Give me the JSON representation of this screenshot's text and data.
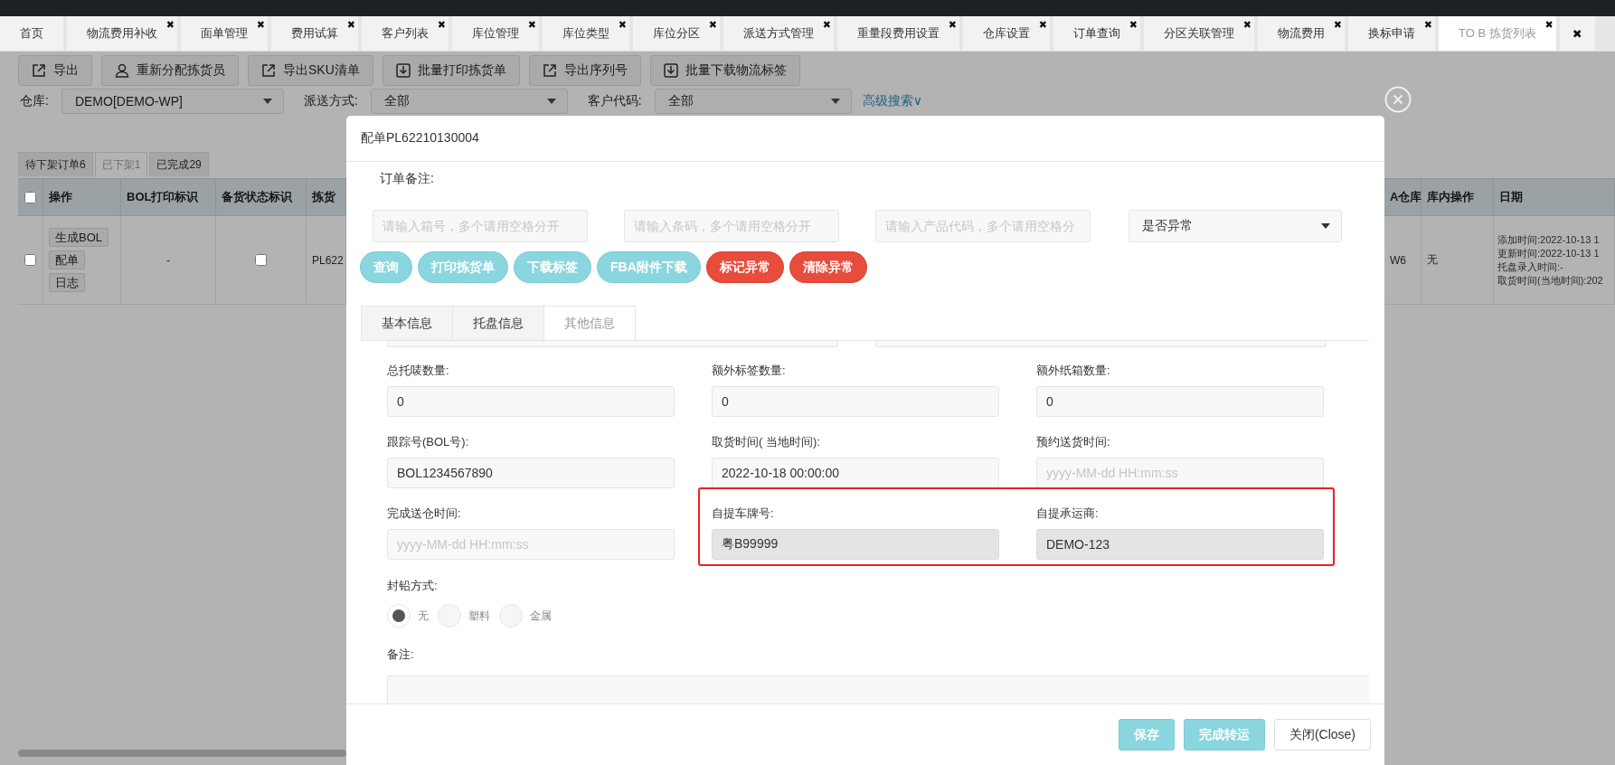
{
  "top_tabs": [
    {
      "kind": "tab",
      "label": "首页",
      "selected": false
    },
    {
      "kind": "tab",
      "label": "物流费用补收",
      "close": "✖",
      "selected": false
    },
    {
      "kind": "tab",
      "label": "面单管理",
      "close": "✖",
      "selected": false
    },
    {
      "kind": "tab",
      "label": "费用试算",
      "close": "✖",
      "selected": false
    },
    {
      "kind": "tab",
      "label": "客户列表",
      "close": "✖",
      "selected": false
    },
    {
      "kind": "tab",
      "label": "库位管理",
      "close": "✖",
      "selected": false
    },
    {
      "kind": "tab",
      "label": "库位类型",
      "close": "✖",
      "selected": false
    },
    {
      "kind": "tab",
      "label": "库位分区",
      "close": "✖",
      "selected": false
    },
    {
      "kind": "tab",
      "label": "派送方式管理",
      "close": "✖",
      "selected": false
    },
    {
      "kind": "tab",
      "label": "重量段费用设置",
      "close": "✖",
      "selected": false
    },
    {
      "kind": "tab",
      "label": "仓库设置",
      "close": "✖",
      "selected": false
    },
    {
      "kind": "tab",
      "label": "订单查询",
      "close": "✖",
      "selected": false
    },
    {
      "kind": "tab",
      "label": "分区关联管理",
      "close": "✖",
      "selected": false
    },
    {
      "kind": "tab",
      "label": "物流费用",
      "close": "✖",
      "selected": false
    },
    {
      "kind": "tab",
      "label": "换标申请",
      "close": "✖",
      "selected": false
    },
    {
      "kind": "tab",
      "label": "TO B 拣货列表",
      "close": "✖",
      "selected": true
    },
    {
      "kind": "close-all",
      "label": "✖"
    }
  ],
  "toolbar": [
    {
      "kind": "export",
      "label": "导出"
    },
    {
      "kind": "user",
      "label": "重新分配拣货员"
    },
    {
      "kind": "export",
      "label": "导出SKU清单"
    },
    {
      "kind": "download",
      "label": "批量打印拣货单"
    },
    {
      "kind": "export",
      "label": "导出序列号"
    },
    {
      "kind": "download",
      "label": "批量下载物流标签"
    }
  ],
  "filters": [
    {
      "label": "仓库:",
      "value": "DEMO[DEMO-WP]"
    },
    {
      "label": "派送方式:",
      "value": "全部"
    },
    {
      "label": "客户代码:",
      "value": "全部"
    }
  ],
  "advanced_search": "高级搜索∨",
  "status_tabs": [
    {
      "label": "待下架订单6",
      "selected": false
    },
    {
      "label": "已下架1",
      "selected": true
    },
    {
      "label": "已完成29",
      "selected": false
    }
  ],
  "table": {
    "header_checked": false,
    "left_columns": [
      "操作",
      "BOL打印标识",
      "备货状态标识",
      "拣货"
    ],
    "right_columns": [
      "A仓库",
      "库内操作",
      "日期"
    ],
    "rows": [
      {
        "selected": false,
        "actions": [
          "生成BOL",
          "配单",
          "日志"
        ],
        "bol_printed": "-",
        "stock_flag": false,
        "pick_no": "PL622",
        "warehouse": "W6",
        "inner_op": "无",
        "dates": [
          "添加时间:2022-10-13 1",
          "更新时间:2022-10-13 1",
          "托盘录入时间:-",
          "取货时间(当地时间):202"
        ]
      }
    ]
  },
  "modal": {
    "title": "配单PL62210130004",
    "order_note_label": "订单备注:",
    "search_fields": [
      {
        "placeholder": "请输入箱号，多个请用空格分开"
      },
      {
        "placeholder": "请输入条码，多个请用空格分开"
      },
      {
        "placeholder": "请输入产品代码，多个请用空格分"
      }
    ],
    "exception_select": "是否异常",
    "actions": [
      {
        "label": "查询",
        "kind": "info"
      },
      {
        "label": "打印拣货单",
        "kind": "info"
      },
      {
        "label": "下载标签",
        "kind": "info"
      },
      {
        "label": "FBA附件下载",
        "kind": "info"
      },
      {
        "label": "标记异常",
        "kind": "danger"
      },
      {
        "label": "清除异常",
        "kind": "danger"
      }
    ],
    "tabs": [
      {
        "label": "基本信息",
        "selected": false
      },
      {
        "label": "托盘信息",
        "selected": false
      },
      {
        "label": "其他信息",
        "selected": true
      }
    ],
    "fields": [
      {
        "label": "总托唛数量:",
        "value": "0",
        "readonly": false,
        "highlighted": false
      },
      {
        "label": "额外标签数量:",
        "value": "0",
        "readonly": false,
        "highlighted": false
      },
      {
        "label": "额外纸箱数量:",
        "value": "0",
        "readonly": false,
        "highlighted": false
      },
      {
        "label": "跟踪号(BOL号):",
        "value": "BOL1234567890",
        "readonly": false,
        "highlighted": false
      },
      {
        "label": "取货时间( 当地时间):",
        "value": "2022-10-18 00:00:00",
        "readonly": false,
        "highlighted": false
      },
      {
        "label": "预约送货时间:",
        "placeholder": "yyyy-MM-dd HH:mm:ss",
        "readonly": false,
        "highlighted": false
      },
      {
        "label": "完成送仓时间:",
        "placeholder": "yyyy-MM-dd HH:mm:ss",
        "readonly": false,
        "highlighted": false
      },
      {
        "label": "自提车牌号:",
        "value": "粤B99999",
        "readonly": true,
        "highlighted": true
      },
      {
        "label": "自提承运商:",
        "value": "DEMO-123",
        "readonly": true,
        "highlighted": true
      }
    ],
    "seal": {
      "label": "封铅方式:",
      "options": [
        {
          "label": "无",
          "selected": true
        },
        {
          "label": "塑料",
          "selected": false
        },
        {
          "label": "金属",
          "selected": false
        }
      ]
    },
    "remark_label": "备注:",
    "footer_buttons": [
      {
        "label": "保存",
        "kind": "primary"
      },
      {
        "label": "完成转运",
        "kind": "primary"
      },
      {
        "label": "关闭(Close)",
        "kind": "default"
      }
    ]
  }
}
